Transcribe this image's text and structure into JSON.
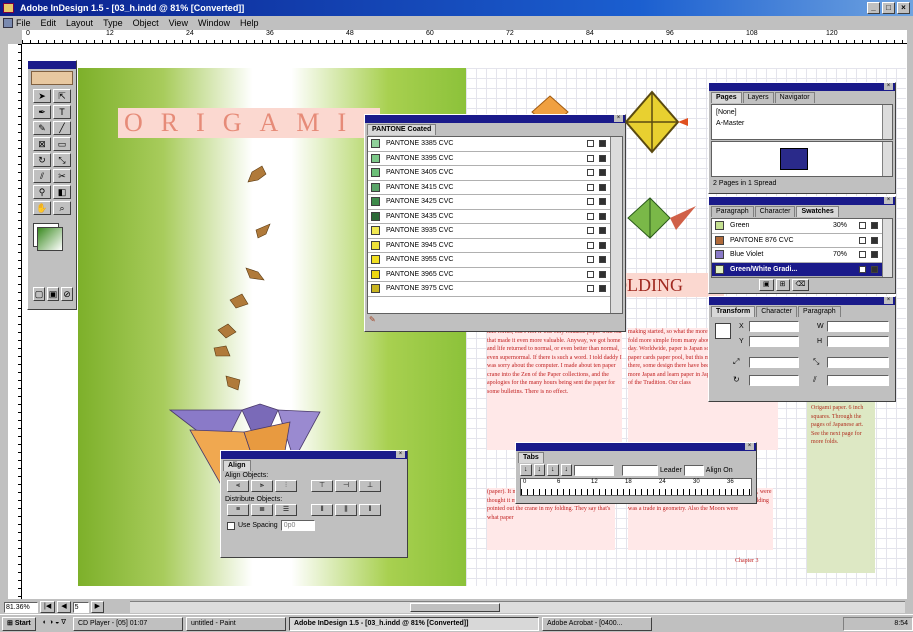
{
  "window": {
    "title": "Adobe InDesign 1.5 - [03_h.indd @ 81% [Converted]]",
    "buttons": [
      "_",
      "□",
      "×"
    ]
  },
  "menubar": [
    "File",
    "Edit",
    "Layout",
    "Type",
    "Object",
    "View",
    "Window",
    "Help"
  ],
  "ruler_numbers": [
    "0",
    "12",
    "24",
    "36",
    "48",
    "60",
    "72",
    "84",
    "96",
    "108",
    "120"
  ],
  "page": {
    "heading_left": "ORIGAMI",
    "heading_right": "OLDING",
    "body_lead": "into forms, but I feel it was only foldable paper with our that made it even more valuable. Anyway, we got home and life returned to normal, or even better than normal, even supernormal. If there is such a word. I told daddy I was sorry about the computer. I made about ten paper crane into the Zen of the Paper collections, and the apologies for the many hours being sent the paper for some bulletins. There is no effect.",
    "body_col2": "making started, so what the more paper folders care paper fold more simple from many about from the country in his day. Worldwide, paper is Japan so the paper. It might, so paper cards paper pool, but this many everyday then and there, some design there have been, once there was only to more Japan and learn paper in Japan 1757 with the public art of the Tradition. Our class",
    "body_bottom": "(paper). It moved to the first century AD in China. It thought it moved to Japan, but foldable quickly pointed out the crane in my folding. They say that's what paper",
    "body_bottom2": "the access of Japan. The Moors, precisely in Japanese, were forbidden to create paper, being Spain. Their paper folding was a trade in geometry. Also the Moors were",
    "sidenote": "Origami paper. 6 inch squares. Through the pages of Japanese art. See the next page for more folds.",
    "page_number": "Chapter 3"
  },
  "swatch_panel": {
    "tab": "PANTONE Coated",
    "items": [
      {
        "name": "PANTONE 3385 CVC",
        "color": "#8fd09a"
      },
      {
        "name": "PANTONE 3395 CVC",
        "color": "#7cc888"
      },
      {
        "name": "PANTONE 3405 CVC",
        "color": "#6cbf78"
      },
      {
        "name": "PANTONE 3415 CVC",
        "color": "#5aa468"
      },
      {
        "name": "PANTONE 3425 CVC",
        "color": "#3d8a4a"
      },
      {
        "name": "PANTONE 3435 CVC",
        "color": "#2d6a38"
      },
      {
        "name": "PANTONE 3935 CVC",
        "color": "#f1e850"
      },
      {
        "name": "PANTONE 3945 CVC",
        "color": "#efe23a"
      },
      {
        "name": "PANTONE 3955 CVC",
        "color": "#f0de20"
      },
      {
        "name": "PANTONE 3965 CVC",
        "color": "#efd810"
      },
      {
        "name": "PANTONE 3975 CVC",
        "color": "#c8b420"
      }
    ]
  },
  "pages_panel": {
    "tabs": [
      "Pages",
      "Layers",
      "Navigator"
    ],
    "items": [
      "[None]",
      "A-Master"
    ],
    "status": "2 Pages in 1 Spread"
  },
  "swatches_panel": {
    "tabs": [
      "Paragraph",
      "Character",
      "Swatches"
    ],
    "items": [
      {
        "name": "Green",
        "value": "30%",
        "color": "#c4e090"
      },
      {
        "name": "PANTONE 876 CVC",
        "value": "",
        "color": "#b06a3a"
      },
      {
        "name": "Blue Violet",
        "value": "70%",
        "color": "#8a7ac8"
      },
      {
        "name": "Green/White Gradi...",
        "value": "",
        "color": "#e0f0c0"
      }
    ]
  },
  "transform_panel": {
    "tabs": [
      "Transform",
      "Character",
      "Paragraph"
    ],
    "labels": [
      "X",
      "Y",
      "W",
      "H"
    ]
  },
  "align_panel": {
    "title": "Align",
    "align_label": "Align Objects:",
    "distribute_label": "Distribute Objects:",
    "spacing_label": "Use Spacing",
    "spacing_value": "0p0"
  },
  "tabs_panel": {
    "title": "Tabs",
    "leader_label": "Leader",
    "align_on_label": "Align On",
    "ruler_numbers": [
      "0",
      "6",
      "12",
      "18",
      "24",
      "30",
      "36"
    ]
  },
  "status": {
    "zoom": "81.36%",
    "page": "5"
  },
  "taskbar": {
    "start": "Start",
    "tasks": [
      {
        "label": "CD Player - [05] 01:07",
        "active": false
      },
      {
        "label": "untitled - Paint",
        "active": false
      },
      {
        "label": "Adobe InDesign 1.5 - [03_h.indd @ 81% [Converted]]",
        "active": true
      },
      {
        "label": "Adobe Acrobat - [0400...",
        "active": false
      }
    ],
    "clock": "8:54"
  }
}
